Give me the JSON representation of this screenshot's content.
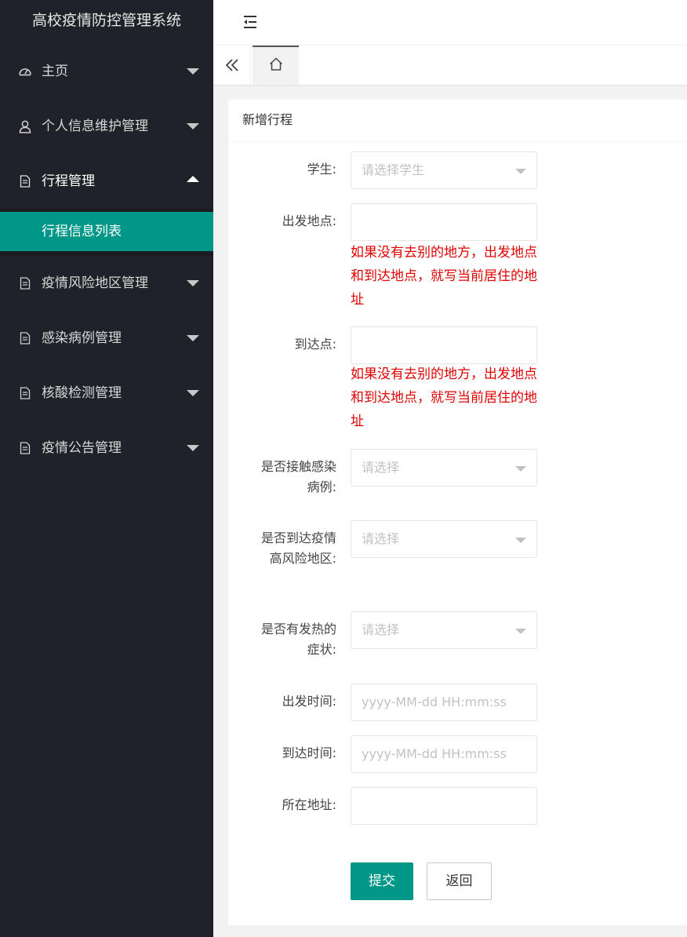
{
  "app": {
    "title": "高校疫情防控管理系统"
  },
  "sidebar": {
    "items": [
      {
        "label": "主页",
        "icon": "dashboard-icon"
      },
      {
        "label": "个人信息维护管理",
        "icon": "user-icon"
      },
      {
        "label": "行程管理",
        "icon": "document-icon",
        "open": true,
        "children": [
          {
            "label": "行程信息列表",
            "active": true
          }
        ]
      },
      {
        "label": "疫情风险地区管理",
        "icon": "document-icon"
      },
      {
        "label": "感染病例管理",
        "icon": "document-icon"
      },
      {
        "label": "核酸检测管理",
        "icon": "document-icon"
      },
      {
        "label": "疫情公告管理",
        "icon": "document-icon"
      }
    ]
  },
  "header": {
    "toggle_icon": "menu-fold-icon"
  },
  "tabs": {
    "prev_icon": "double-chevron-left-icon",
    "home_icon": "home-icon"
  },
  "form": {
    "title": "新增行程",
    "student": {
      "label": "学生:",
      "placeholder": "请选择学生"
    },
    "departure": {
      "label": "出发地点:",
      "value": "",
      "hint": "如果没有去别的地方，出发地点和到达地点，就写当前居住的地址"
    },
    "arrival": {
      "label": "到达点:",
      "value": "",
      "hint": "如果没有去别的地方，出发地点和到达地点，就写当前居住的地址"
    },
    "contact_case": {
      "label": "是否接触感染病例:",
      "placeholder": "请选择"
    },
    "high_risk": {
      "label": "是否到达疫情高风险地区:",
      "placeholder": "请选择"
    },
    "fever": {
      "label": "是否有发热的症状:",
      "placeholder": "请选择"
    },
    "depart_time": {
      "label": "出发时间:",
      "placeholder": "yyyy-MM-dd HH:mm:ss"
    },
    "arrive_time": {
      "label": "到达时间:",
      "placeholder": "yyyy-MM-dd HH:mm:ss"
    },
    "address": {
      "label": "所在地址:",
      "value": ""
    },
    "submit_label": "提交",
    "back_label": "返回"
  },
  "colors": {
    "sidebar_bg": "#20222a",
    "accent": "#009688",
    "hint": "#e00000"
  }
}
